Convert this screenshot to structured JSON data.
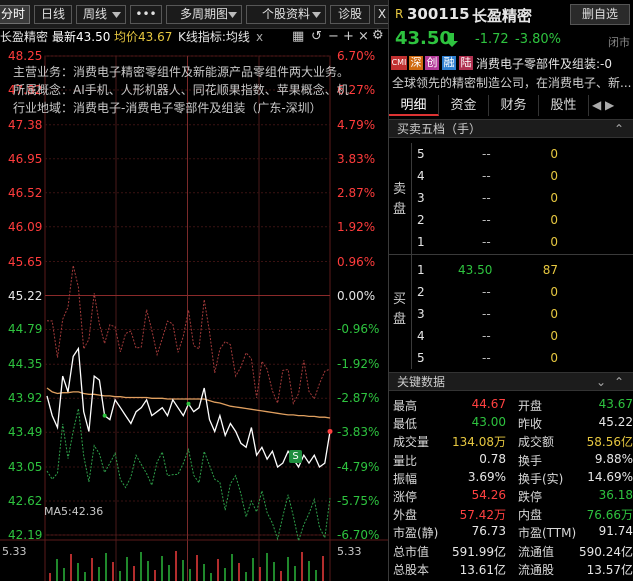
{
  "toolbar": {
    "buttons": [
      "分时",
      "日线",
      "周线",
      "•••",
      "多周期图",
      "个股资料",
      "诊股",
      "X"
    ]
  },
  "quote_header": {
    "short_name": "长盈精密",
    "latest_label": "最新43.50",
    "avg_label": "均价43.67",
    "indicator_label": "K线指标:均线",
    "close_glyph": "x"
  },
  "chart": {
    "price_ticks": [
      "48.25",
      "47.82",
      "47.38",
      "46.95",
      "46.52",
      "46.09",
      "45.65",
      "45.22",
      "44.79",
      "44.35",
      "43.92",
      "43.49",
      "43.05",
      "42.62",
      "42.19"
    ],
    "pct_ticks": [
      "6.70%",
      "6.27%",
      "4.79%",
      "3.83%",
      "2.87%",
      "1.92%",
      "0.96%",
      "0.00%",
      "-0.96%",
      "-1.92%",
      "-2.87%",
      "-3.83%",
      "-4.79%",
      "-5.75%",
      "-6.70%"
    ],
    "pct_colors": [
      "#ff3c3c",
      "#ff3c3c",
      "#ff3c3c",
      "#ff3c3c",
      "#ff3c3c",
      "#ff3c3c",
      "#ff3c3c",
      "#e6e6e6",
      "#2ec33f",
      "#2ec33f",
      "#2ec33f",
      "#2ec33f",
      "#2ec33f",
      "#2ec33f",
      "#2ec33f"
    ],
    "business_lines": [
      "主营业务：消费电子精密零组件及新能源产品零组件两大业务。",
      "所属概念：AI手机、人形机器人、同花顺果指数、苹果概念、机",
      "行业地域：消费电子-消费电子零部件及组装（广东-深圳）"
    ],
    "ma5_label": "MA5:42.36",
    "volume_left": "5.33",
    "volume_right": "5.33",
    "marker_s": "S",
    "y_min": 42.19,
    "y_max": 48.25,
    "prev_close": 45.22
  },
  "chart_data": {
    "type": "line",
    "title": "",
    "xlabel": "",
    "ylabel": "",
    "ylim": [
      42.19,
      48.25
    ],
    "series": [
      {
        "name": "price",
        "values": [
          43.95,
          43.7,
          43.55,
          44.2,
          44.0,
          44.45,
          44.55,
          43.75,
          43.5,
          44.2,
          44.15,
          43.7,
          43.65,
          43.9,
          43.8,
          43.7,
          43.6,
          43.75,
          43.8,
          43.9,
          43.7,
          43.75,
          43.8,
          43.7,
          43.9,
          43.8,
          43.7,
          43.85,
          43.75,
          43.8,
          44.05,
          43.65,
          43.5,
          43.7,
          43.45,
          43.6,
          43.5,
          43.35,
          43.3,
          43.55,
          43.2,
          43.3,
          43.15,
          43.25,
          43.05,
          43.1,
          43.25,
          43.15,
          43.05,
          43.2,
          43.1,
          43.2,
          43.05,
          43.1,
          43.5
        ]
      },
      {
        "name": "average",
        "values": [
          44.05,
          44.0,
          43.98,
          43.99,
          43.99,
          44.0,
          44.0,
          43.98,
          43.97,
          43.97,
          43.96,
          43.95,
          43.95,
          43.94,
          43.94,
          43.93,
          43.93,
          43.93,
          43.93,
          43.93,
          43.92,
          43.92,
          43.92,
          43.91,
          43.91,
          43.91,
          43.91,
          43.91,
          43.91,
          43.91,
          43.91,
          43.89,
          43.87,
          43.86,
          43.84,
          43.82,
          43.81,
          43.8,
          43.79,
          43.78,
          43.77,
          43.76,
          43.75,
          43.74,
          43.73,
          43.72,
          43.71,
          43.71,
          43.7,
          43.7,
          43.69,
          43.69,
          43.68,
          43.68,
          43.67
        ]
      }
    ]
  },
  "right_panel": {
    "code_prefix": "R",
    "code": "300115",
    "name": "长盈精密",
    "watch_button": "删自选",
    "price": "43.50",
    "change": "-1.72",
    "change_pct": "-3.80%",
    "status": "闭市",
    "tags": [
      {
        "text": "CMI",
        "color": "#c03030"
      },
      {
        "text": "深",
        "color": "#d06a10"
      },
      {
        "text": "创",
        "color": "#b33a99"
      },
      {
        "text": "融",
        "color": "#2f7fd0"
      },
      {
        "text": "陆",
        "color": "#b03050"
      }
    ],
    "tag_line": "消费电子零部件及组装:-0",
    "desc": "全球领先的精密制造公司，在消费电子、新...",
    "tabs": [
      "明细",
      "资金",
      "财务",
      "股性"
    ],
    "orderbook_title": "买卖五档（手）",
    "sell_label": "卖盘",
    "buy_label": "买盘",
    "sell_rows": [
      {
        "level": "5",
        "price": "--",
        "vol": "0"
      },
      {
        "level": "4",
        "price": "--",
        "vol": "0"
      },
      {
        "level": "3",
        "price": "--",
        "vol": "0"
      },
      {
        "level": "2",
        "price": "--",
        "vol": "0"
      },
      {
        "level": "1",
        "price": "--",
        "vol": "0"
      }
    ],
    "buy_rows": [
      {
        "level": "1",
        "price": "43.50",
        "vol": "87"
      },
      {
        "level": "2",
        "price": "--",
        "vol": "0"
      },
      {
        "level": "3",
        "price": "--",
        "vol": "0"
      },
      {
        "level": "4",
        "price": "--",
        "vol": "0"
      },
      {
        "level": "5",
        "price": "--",
        "vol": "0"
      }
    ],
    "key_data_title": "关键数据",
    "key_data": [
      {
        "l1": "最高",
        "v1": "44.67",
        "c1": "#ff4040",
        "l2": "开盘",
        "v2": "43.67",
        "c2": "#2ec33f"
      },
      {
        "l1": "最低",
        "v1": "43.00",
        "c1": "#2ec33f",
        "l2": "昨收",
        "v2": "45.22",
        "c2": "#e6e6e6"
      },
      {
        "l1": "成交量",
        "v1": "134.08万",
        "c1": "#e6c740",
        "l2": "成交额",
        "v2": "58.56亿",
        "c2": "#e6c740"
      },
      {
        "l1": "量比",
        "v1": "0.78",
        "c1": "#e6e6e6",
        "l2": "换手",
        "v2": "9.88%",
        "c2": "#e6e6e6"
      },
      {
        "l1": "振幅",
        "v1": "3.69%",
        "c1": "#e6e6e6",
        "l2": "换手(实)",
        "v2": "14.69%",
        "c2": "#e6e6e6"
      },
      {
        "l1": "涨停",
        "v1": "54.26",
        "c1": "#ff4040",
        "l2": "跌停",
        "v2": "36.18",
        "c2": "#2ec33f"
      },
      {
        "l1": "外盘",
        "v1": "57.42万",
        "c1": "#ff4040",
        "l2": "内盘",
        "v2": "76.66万",
        "c2": "#2ec33f"
      },
      {
        "l1": "市盈(静)",
        "v1": "76.73",
        "c1": "#e6e6e6",
        "l2": "市盈(TTM)",
        "v2": "91.74",
        "c2": "#e6e6e6"
      },
      {
        "l1": "总市值",
        "v1": "591.99亿",
        "c1": "#e6e6e6",
        "l2": "流通值",
        "v2": "590.24亿",
        "c2": "#e6e6e6"
      },
      {
        "l1": "总股本",
        "v1": "13.61亿",
        "c1": "#e6e6e6",
        "l2": "流通股",
        "v2": "13.57亿",
        "c2": "#e6e6e6"
      }
    ]
  }
}
